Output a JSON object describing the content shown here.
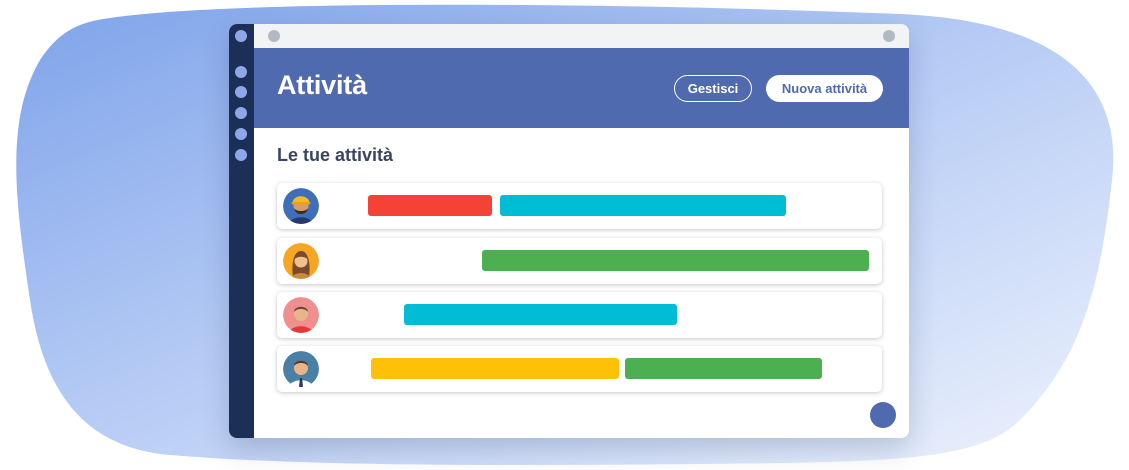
{
  "header": {
    "title": "Attività",
    "manage_label": "Gestisci",
    "new_label": "Nuova attività"
  },
  "section": {
    "title": "Le tue attività"
  },
  "colors": {
    "header": "#4f6aae",
    "sidebar": "#1c2f57",
    "red": "#f44336",
    "cyan": "#00bcd4",
    "green": "#4caf50",
    "yellow": "#ffc107"
  },
  "rows": [
    {
      "avatar": "worker-with-hardhat-avatar",
      "tasks": [
        "red",
        "cyan"
      ]
    },
    {
      "avatar": "woman-avatar",
      "tasks": [
        "green"
      ]
    },
    {
      "avatar": "man-red-shirt-avatar",
      "tasks": [
        "cyan"
      ]
    },
    {
      "avatar": "businessman-avatar",
      "tasks": [
        "yellow",
        "green"
      ]
    }
  ]
}
